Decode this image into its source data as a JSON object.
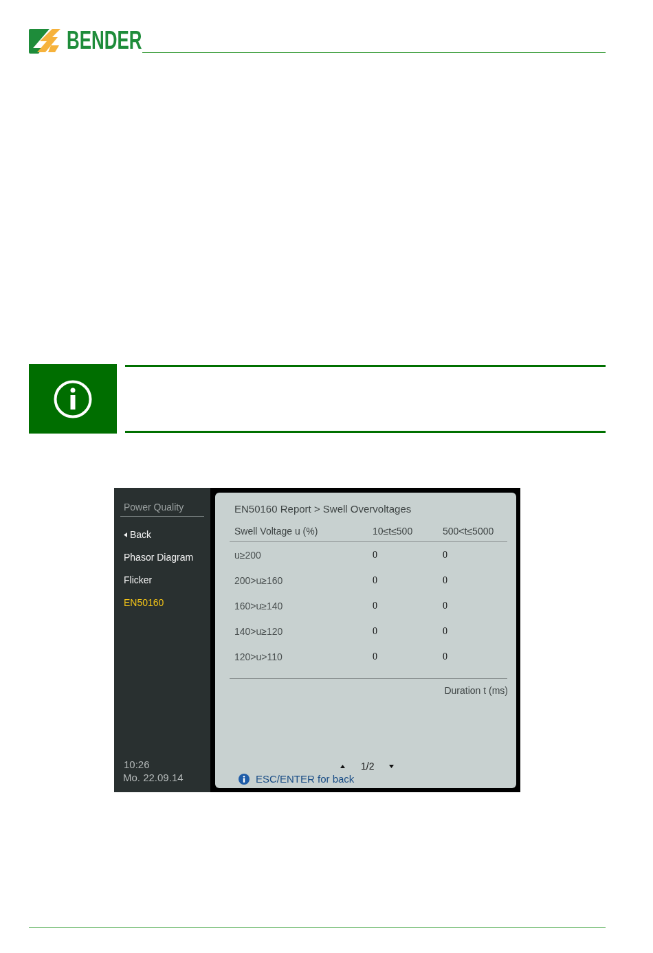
{
  "logo": {
    "text": "BENDER"
  },
  "device_screen": {
    "sidebar": {
      "title": "Power Quality",
      "items": [
        {
          "kind": "back",
          "label": "Back",
          "selected": false
        },
        {
          "kind": "link",
          "label": "Phasor Diagram",
          "selected": false
        },
        {
          "kind": "link",
          "label": "Flicker",
          "selected": false
        },
        {
          "kind": "link",
          "label": "EN50160",
          "selected": true
        }
      ],
      "time": "10:26",
      "date": "Mo. 22.09.14"
    },
    "content": {
      "breadcrumb": "EN50160 Report > Swell Overvoltages",
      "table": {
        "columns": [
          "Swell Voltage u (%)",
          "10≤t≤500",
          "500<t≤5000"
        ],
        "rows": [
          [
            "u≥200",
            "0",
            "0"
          ],
          [
            "200>u≥160",
            "0",
            "0"
          ],
          [
            "160>u≥140",
            "0",
            "0"
          ],
          [
            "140>u≥120",
            "0",
            "0"
          ],
          [
            "120>u>110",
            "0",
            "0"
          ]
        ]
      },
      "axis_label": "Duration t (ms)",
      "pager": "1/2",
      "hint": "ESC/ENTER for back"
    }
  }
}
